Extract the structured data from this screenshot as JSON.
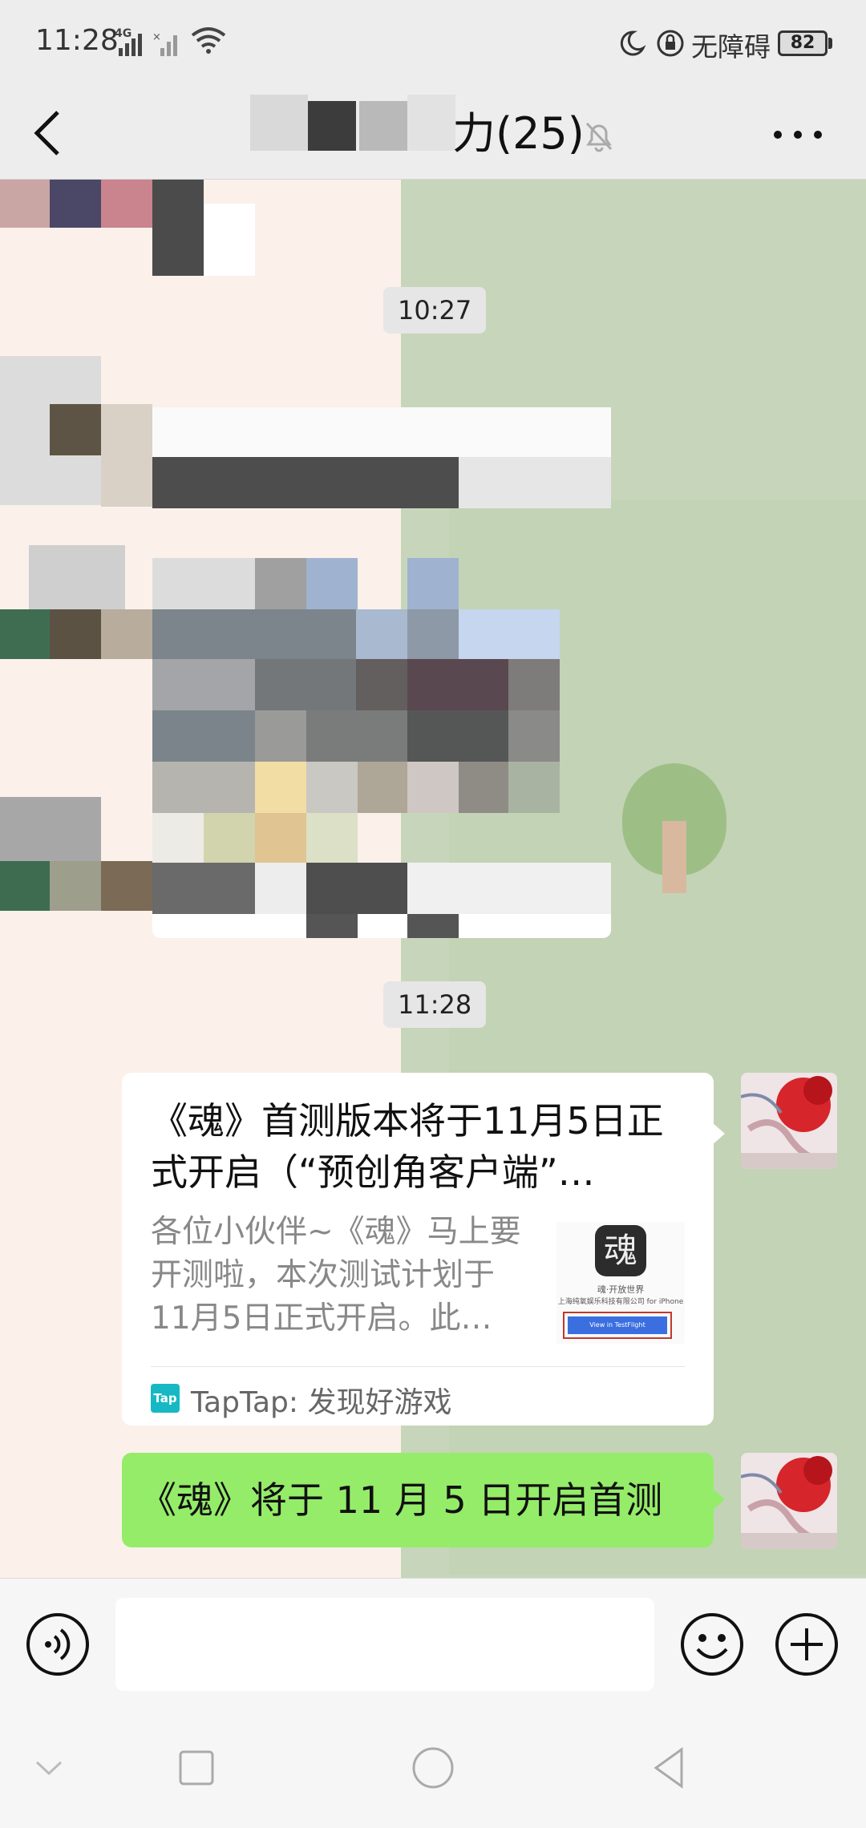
{
  "status_bar": {
    "time": "11:28",
    "network": "4G",
    "accessibility_label": "无障碍",
    "battery_level": "82"
  },
  "title_bar": {
    "title_visible": "力(25)"
  },
  "chat": {
    "timestamps": [
      "10:27",
      "11:28"
    ],
    "link_card": {
      "title": "《魂》首测版本将于11月5日正式开启（“预创角客户端”…",
      "description": "各位小伙伴~《魂》马上要开测啦，本次测试计划于11月5日正式开启。此…",
      "thumbnail": {
        "logo_char": "魂",
        "line1": "魂·开放世界",
        "line2": "上海纯氧娱乐科技有限公司 for iPhone",
        "button": "View in TestFlight"
      },
      "source_icon": "Tap",
      "source": "TapTap: 发现好游戏"
    },
    "text_message": "《魂》将于 11 月 5 日开启首测"
  },
  "input_bar": {
    "placeholder": ""
  },
  "icons": {
    "back": "back-arrow-icon",
    "mute": "bell-muted-icon",
    "more": "more-dots-icon",
    "voice": "voice-icon",
    "emoji": "emoji-icon",
    "plus": "plus-icon"
  },
  "colors": {
    "bubble_green": "#95ec69",
    "card_white": "#ffffff",
    "chat_bg_pink": "#fbf0ea",
    "chat_bg_green": "#c7d6bb"
  }
}
